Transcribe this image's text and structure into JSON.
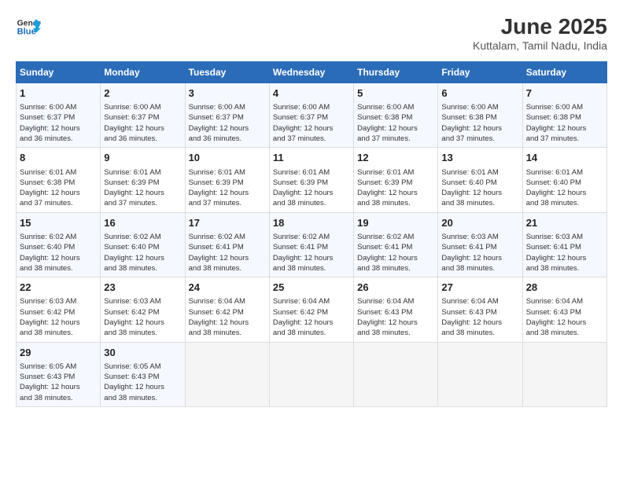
{
  "logo": {
    "line1": "General",
    "line2": "Blue"
  },
  "title": "June 2025",
  "location": "Kuttalam, Tamil Nadu, India",
  "days_of_week": [
    "Sunday",
    "Monday",
    "Tuesday",
    "Wednesday",
    "Thursday",
    "Friday",
    "Saturday"
  ],
  "weeks": [
    [
      {
        "day": "1",
        "info": "Sunrise: 6:00 AM\nSunset: 6:37 PM\nDaylight: 12 hours\nand 36 minutes."
      },
      {
        "day": "2",
        "info": "Sunrise: 6:00 AM\nSunset: 6:37 PM\nDaylight: 12 hours\nand 36 minutes."
      },
      {
        "day": "3",
        "info": "Sunrise: 6:00 AM\nSunset: 6:37 PM\nDaylight: 12 hours\nand 36 minutes."
      },
      {
        "day": "4",
        "info": "Sunrise: 6:00 AM\nSunset: 6:37 PM\nDaylight: 12 hours\nand 37 minutes."
      },
      {
        "day": "5",
        "info": "Sunrise: 6:00 AM\nSunset: 6:38 PM\nDaylight: 12 hours\nand 37 minutes."
      },
      {
        "day": "6",
        "info": "Sunrise: 6:00 AM\nSunset: 6:38 PM\nDaylight: 12 hours\nand 37 minutes."
      },
      {
        "day": "7",
        "info": "Sunrise: 6:00 AM\nSunset: 6:38 PM\nDaylight: 12 hours\nand 37 minutes."
      }
    ],
    [
      {
        "day": "8",
        "info": "Sunrise: 6:01 AM\nSunset: 6:38 PM\nDaylight: 12 hours\nand 37 minutes."
      },
      {
        "day": "9",
        "info": "Sunrise: 6:01 AM\nSunset: 6:39 PM\nDaylight: 12 hours\nand 37 minutes."
      },
      {
        "day": "10",
        "info": "Sunrise: 6:01 AM\nSunset: 6:39 PM\nDaylight: 12 hours\nand 37 minutes."
      },
      {
        "day": "11",
        "info": "Sunrise: 6:01 AM\nSunset: 6:39 PM\nDaylight: 12 hours\nand 38 minutes."
      },
      {
        "day": "12",
        "info": "Sunrise: 6:01 AM\nSunset: 6:39 PM\nDaylight: 12 hours\nand 38 minutes."
      },
      {
        "day": "13",
        "info": "Sunrise: 6:01 AM\nSunset: 6:40 PM\nDaylight: 12 hours\nand 38 minutes."
      },
      {
        "day": "14",
        "info": "Sunrise: 6:01 AM\nSunset: 6:40 PM\nDaylight: 12 hours\nand 38 minutes."
      }
    ],
    [
      {
        "day": "15",
        "info": "Sunrise: 6:02 AM\nSunset: 6:40 PM\nDaylight: 12 hours\nand 38 minutes."
      },
      {
        "day": "16",
        "info": "Sunrise: 6:02 AM\nSunset: 6:40 PM\nDaylight: 12 hours\nand 38 minutes."
      },
      {
        "day": "17",
        "info": "Sunrise: 6:02 AM\nSunset: 6:41 PM\nDaylight: 12 hours\nand 38 minutes."
      },
      {
        "day": "18",
        "info": "Sunrise: 6:02 AM\nSunset: 6:41 PM\nDaylight: 12 hours\nand 38 minutes."
      },
      {
        "day": "19",
        "info": "Sunrise: 6:02 AM\nSunset: 6:41 PM\nDaylight: 12 hours\nand 38 minutes."
      },
      {
        "day": "20",
        "info": "Sunrise: 6:03 AM\nSunset: 6:41 PM\nDaylight: 12 hours\nand 38 minutes."
      },
      {
        "day": "21",
        "info": "Sunrise: 6:03 AM\nSunset: 6:41 PM\nDaylight: 12 hours\nand 38 minutes."
      }
    ],
    [
      {
        "day": "22",
        "info": "Sunrise: 6:03 AM\nSunset: 6:42 PM\nDaylight: 12 hours\nand 38 minutes."
      },
      {
        "day": "23",
        "info": "Sunrise: 6:03 AM\nSunset: 6:42 PM\nDaylight: 12 hours\nand 38 minutes."
      },
      {
        "day": "24",
        "info": "Sunrise: 6:04 AM\nSunset: 6:42 PM\nDaylight: 12 hours\nand 38 minutes."
      },
      {
        "day": "25",
        "info": "Sunrise: 6:04 AM\nSunset: 6:42 PM\nDaylight: 12 hours\nand 38 minutes."
      },
      {
        "day": "26",
        "info": "Sunrise: 6:04 AM\nSunset: 6:43 PM\nDaylight: 12 hours\nand 38 minutes."
      },
      {
        "day": "27",
        "info": "Sunrise: 6:04 AM\nSunset: 6:43 PM\nDaylight: 12 hours\nand 38 minutes."
      },
      {
        "day": "28",
        "info": "Sunrise: 6:04 AM\nSunset: 6:43 PM\nDaylight: 12 hours\nand 38 minutes."
      }
    ],
    [
      {
        "day": "29",
        "info": "Sunrise: 6:05 AM\nSunset: 6:43 PM\nDaylight: 12 hours\nand 38 minutes."
      },
      {
        "day": "30",
        "info": "Sunrise: 6:05 AM\nSunset: 6:43 PM\nDaylight: 12 hours\nand 38 minutes."
      },
      {
        "day": "",
        "info": ""
      },
      {
        "day": "",
        "info": ""
      },
      {
        "day": "",
        "info": ""
      },
      {
        "day": "",
        "info": ""
      },
      {
        "day": "",
        "info": ""
      }
    ]
  ]
}
